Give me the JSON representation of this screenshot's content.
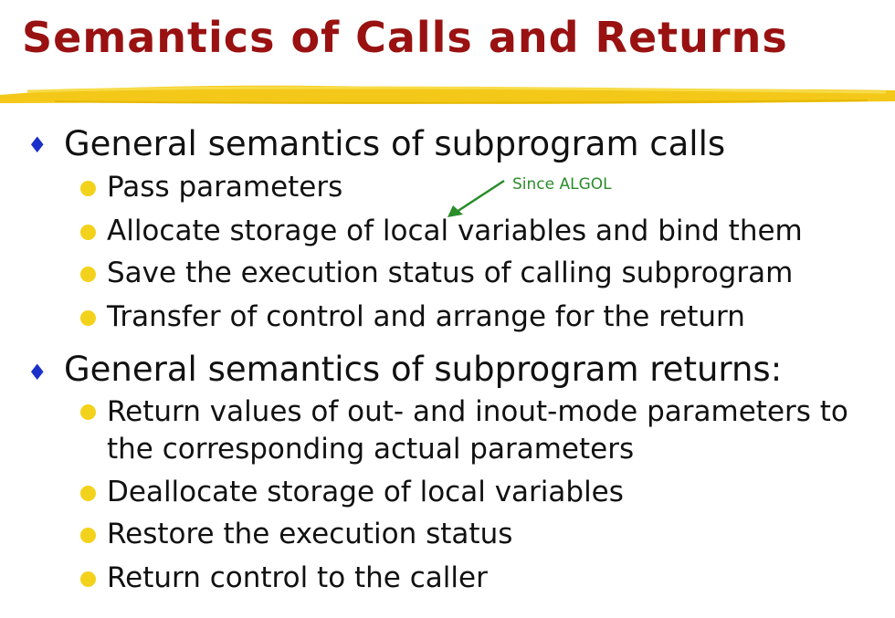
{
  "title": "Semantics of Calls and Returns",
  "sections": [
    {
      "heading": "General semantics of subprogram calls",
      "items": [
        "Pass parameters",
        "Allocate storage of local variables and bind them",
        "Save the execution status of calling subprogram",
        "Transfer of control and arrange for the return"
      ]
    },
    {
      "heading": "General semantics of subprogram returns:",
      "items": [
        "Return values of out- and inout-mode parameters to",
        "the corresponding actual parameters",
        "Deallocate storage of local variables",
        "Restore the execution status",
        "Return control to the caller"
      ]
    }
  ],
  "annotation": "Since ALGOL",
  "colors": {
    "title": "#991111",
    "underline": "#f2c200",
    "diamond_bullet": "#1a30c8",
    "dot_bullet": "#f3d21b",
    "annotation": "#2a8c2a"
  },
  "icons": [
    "diamond-bullet-icon",
    "dot-bullet-icon",
    "arrow-icon"
  ]
}
